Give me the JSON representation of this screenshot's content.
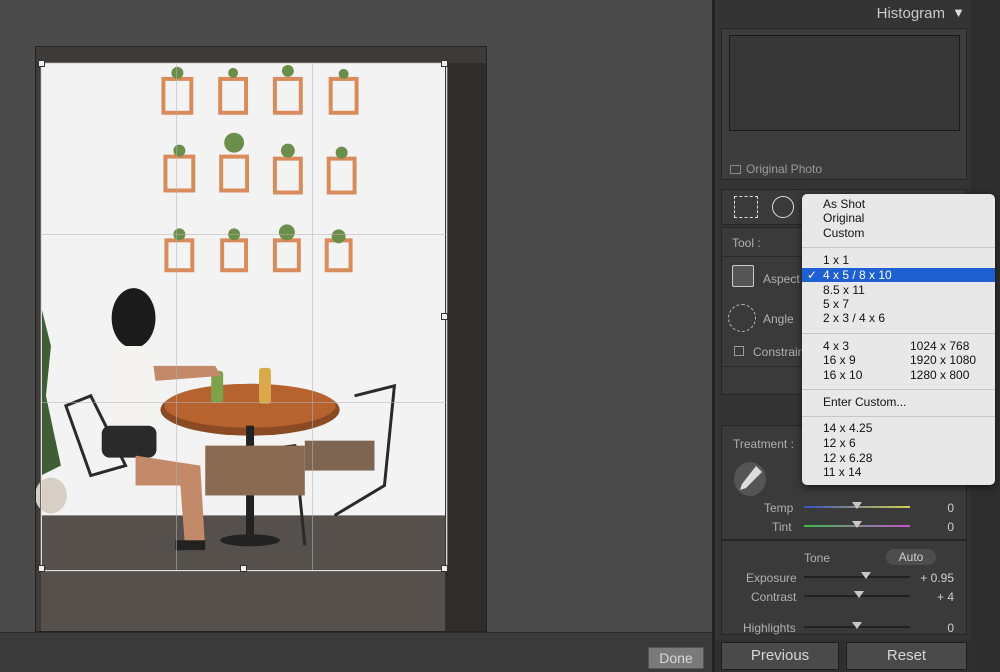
{
  "histogram": {
    "title": "Histogram",
    "toggle_icon": "▼",
    "original_photo_label": "Original Photo"
  },
  "crop_panel": {
    "tool_label": "Tool :",
    "aspect_label": "Aspect",
    "angle_label": "Angle",
    "constrain_label": "Constrain"
  },
  "aspect_menu": {
    "group1": [
      "As Shot",
      "Original",
      "Custom"
    ],
    "group2": [
      "1 x 1",
      "4 x 5  /  8 x 10",
      "8.5 x 11",
      "5 x 7",
      "2 x 3  /  4 x 6"
    ],
    "selected": "4 x 5  /  8 x 10",
    "check_mark": "✓",
    "group3": [
      {
        "left": "4 x 3",
        "right": "1024 x 768"
      },
      {
        "left": "16 x 9",
        "right": "1920 x 1080"
      },
      {
        "left": "16 x 10",
        "right": "1280 x 800"
      }
    ],
    "enter_custom": "Enter Custom...",
    "group4": [
      "14 x 4.25",
      "12 x 6",
      "12 x 6.28",
      "11 x 14"
    ]
  },
  "basic": {
    "treatment_label": "Treatment :",
    "temp_label": "Temp",
    "temp_value": "0",
    "tint_label": "Tint",
    "tint_value": "0",
    "tone_label": "Tone",
    "auto_label": "Auto",
    "exposure_label": "Exposure",
    "exposure_value": "+ 0.95",
    "contrast_label": "Contrast",
    "contrast_value": "+ 4",
    "highlights_label": "Highlights",
    "highlights_value": "0"
  },
  "bottom": {
    "done_label": "Done",
    "previous_label": "Previous",
    "reset_label": "Reset"
  },
  "colors": {
    "panel_bg": "#343434",
    "menu_highlight": "#1e5fd1",
    "canvas_bg": "#4a4a4a"
  }
}
